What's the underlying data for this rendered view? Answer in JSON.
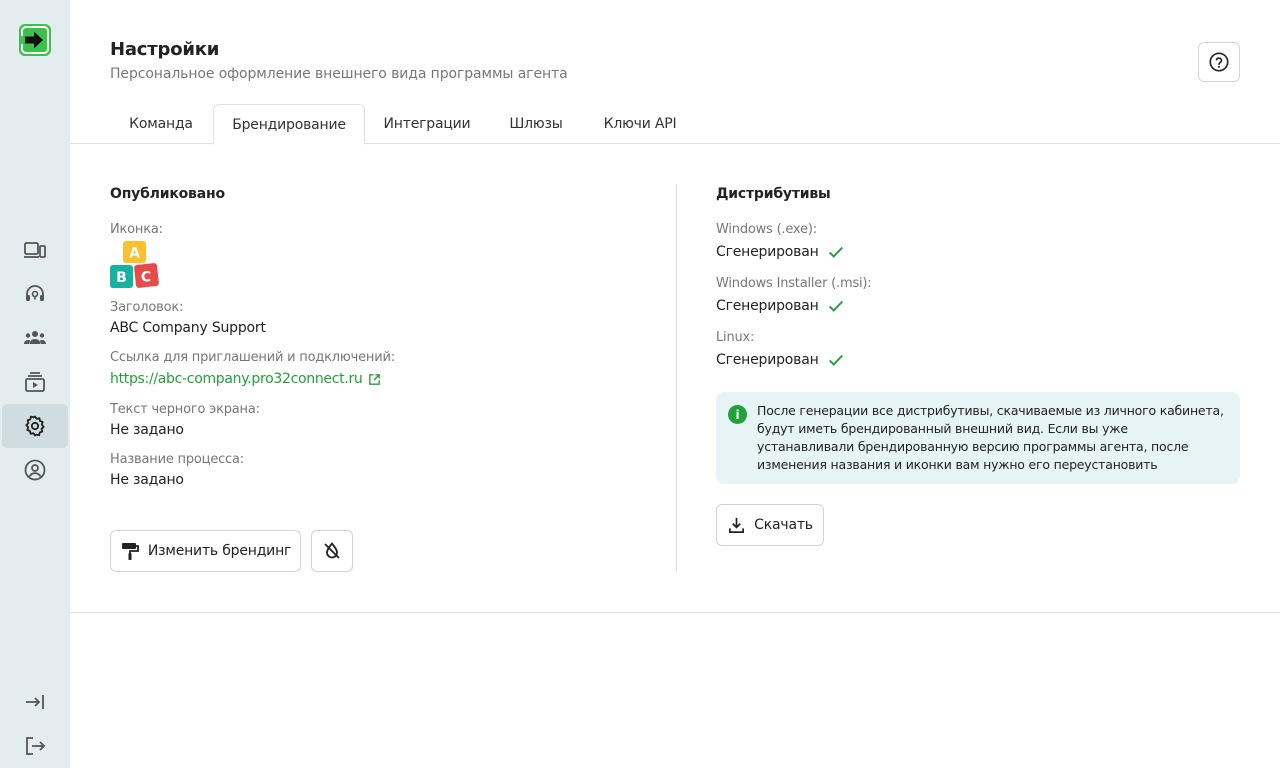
{
  "header": {
    "title": "Настройки",
    "subtitle": "Персональное оформление внешнего вида программы агента"
  },
  "tabs": [
    {
      "label": "Команда"
    },
    {
      "label": "Брендирование",
      "active": true
    },
    {
      "label": "Интеграции"
    },
    {
      "label": "Шлюзы"
    },
    {
      "label": "Ключи API"
    }
  ],
  "published": {
    "title": "Опубликовано",
    "icon_label": "Иконка:",
    "icon_letters": [
      "A",
      "B",
      "C"
    ],
    "heading_label": "Заголовок:",
    "heading_value": "ABC Company Support",
    "link_label": "Ссылка для приглашений и подключений:",
    "link_value": "https://abc-company.pro32connect.ru",
    "black_screen_label": "Текст черного экрана:",
    "black_screen_value": "Не задано",
    "process_label": "Название процесса:",
    "process_value": "Не задано",
    "edit_button": "Изменить брендинг"
  },
  "distributions": {
    "title": "Дистрибутивы",
    "items": [
      {
        "label": "Windows (.exe):",
        "status": "Сгенерирован"
      },
      {
        "label": "Windows Installer (.msi):",
        "status": "Сгенерирован"
      },
      {
        "label": "Linux:",
        "status": "Сгенерирован"
      }
    ],
    "info": "После генерации все дистрибутивы, скачиваемые из личного кабинета, будут иметь брендированный внешний вид. Если вы уже устанавливали брендированную версию программы агента, после изменения названия и иконки вам нужно его переустановить",
    "download_button": "Скачать"
  },
  "colors": {
    "accent": "#22a03a",
    "sidebar_bg": "#e3ecee",
    "info_bg": "#e6f4f6"
  }
}
